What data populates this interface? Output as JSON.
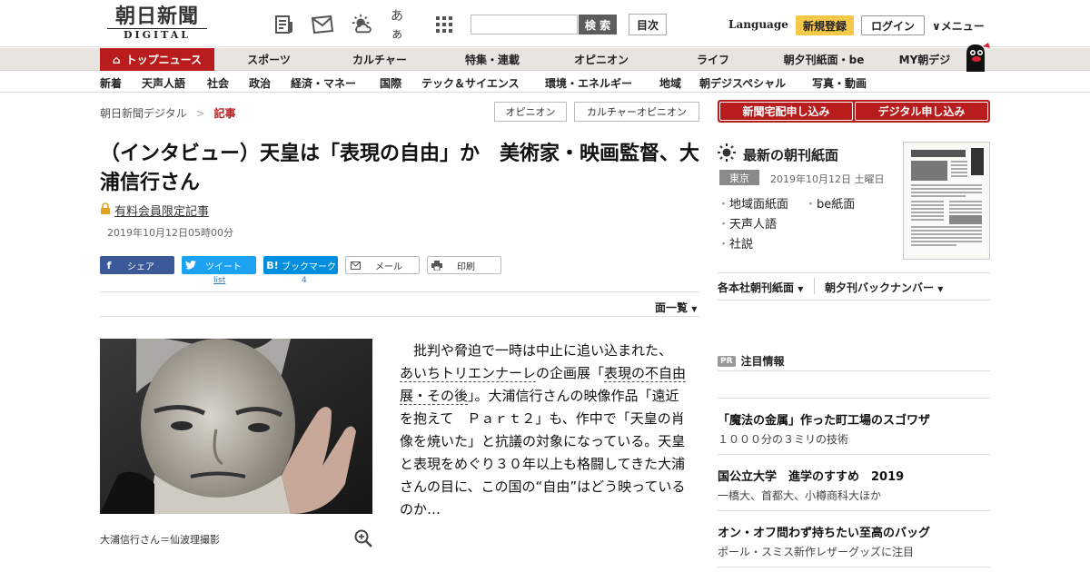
{
  "header": {
    "logo_ja": "朝日新聞",
    "logo_en": "DIGITAL",
    "icons": [
      "newspaper-icon",
      "mail-icon",
      "weather-icon",
      "font-size-icon",
      "grid-icon"
    ],
    "font_icon_text": "あぁ",
    "search_placeholder": "",
    "search_label": "検 索",
    "index_label": "目次",
    "language_label": "Language",
    "register_label": "新規登録",
    "login_label": "ログイン",
    "menu_label": "メニュー"
  },
  "nav_main": [
    "トップニュース",
    "スポーツ",
    "カルチャー",
    "特集・連載",
    "オピニオン",
    "ライフ",
    "朝夕刊紙面・be",
    "MY朝デジ"
  ],
  "nav_sub": [
    "新着",
    "天声人語",
    "社会",
    "政治",
    "経済・マネー",
    "国際",
    "テック＆サイエンス",
    "環境・エネルギー",
    "地域",
    "朝デジスペシャル",
    "写真・動画"
  ],
  "breadcrumb": {
    "home": "朝日新聞デジタル",
    "sep": ">",
    "current": "記事"
  },
  "tags": [
    "オピニオン",
    "カルチャーオピニオン"
  ],
  "article": {
    "title": "（インタビュー）天皇は「表現の自由」か　美術家・映画監督、大浦信行さん",
    "paid_label": "有料会員限定記事",
    "date": "2019年10月12日05時00分",
    "share": {
      "facebook": "シェア",
      "twitter": "ツイート",
      "hatena": "ブックマーク",
      "mail": "メール",
      "print": "印刷"
    },
    "twitter_count": "list",
    "hatena_count": "4",
    "page_list": "面一覧",
    "caption": "大浦信行さん＝仙波理撮影",
    "body_1": "批判や脅迫で一時は中止に追い込まれた、",
    "body_link1": "あいちトリエンナーレ",
    "body_2": "の企画展「",
    "body_link2": "表現の不自由展・その後",
    "body_3": "」。大浦信行さんの映像作品「遠近を抱えて　Ｐａｒｔ２」も、作中で「天皇の肖像を焼いた」と抗議の対象になっている。天皇と表現をめぐり３０年以上も格闘してきた大浦さんの目に、この国の“自由”はどう映っているのか…"
  },
  "sidebar": {
    "home_delivery": "新聞宅配申し込み",
    "digital_signup": "デジタル申し込み",
    "chokan_title": "最新の朝刊紙面",
    "region": "東京",
    "chokan_date": "2019年10月12日 土曜日",
    "chokan_links": [
      "地域面紙面",
      "be紙面",
      "天声人語",
      "社説"
    ],
    "dropdown_1": "各本社朝刊紙面",
    "dropdown_2": "朝夕刊バックナンバー",
    "pr_badge": "PR",
    "pr_title": "注目情報",
    "ads": [
      {
        "title": "「魔法の金属」作った町工場のスゴワザ",
        "sub": "１０００分の３ミリの技術"
      },
      {
        "title": "国公立大学　進学のすすめ　2019",
        "sub": "一橋大、首都大、小樽商科大ほか"
      },
      {
        "title": "オン・オフ問わず持ちたい至高のバッグ",
        "sub": "ポール・スミス新作レザーグッズに注目"
      }
    ]
  },
  "colors": {
    "accent": "#b81c1c",
    "register": "#f6c84a",
    "facebook": "#3b5998",
    "twitter": "#1da1f2",
    "hatena": "#008fde"
  }
}
